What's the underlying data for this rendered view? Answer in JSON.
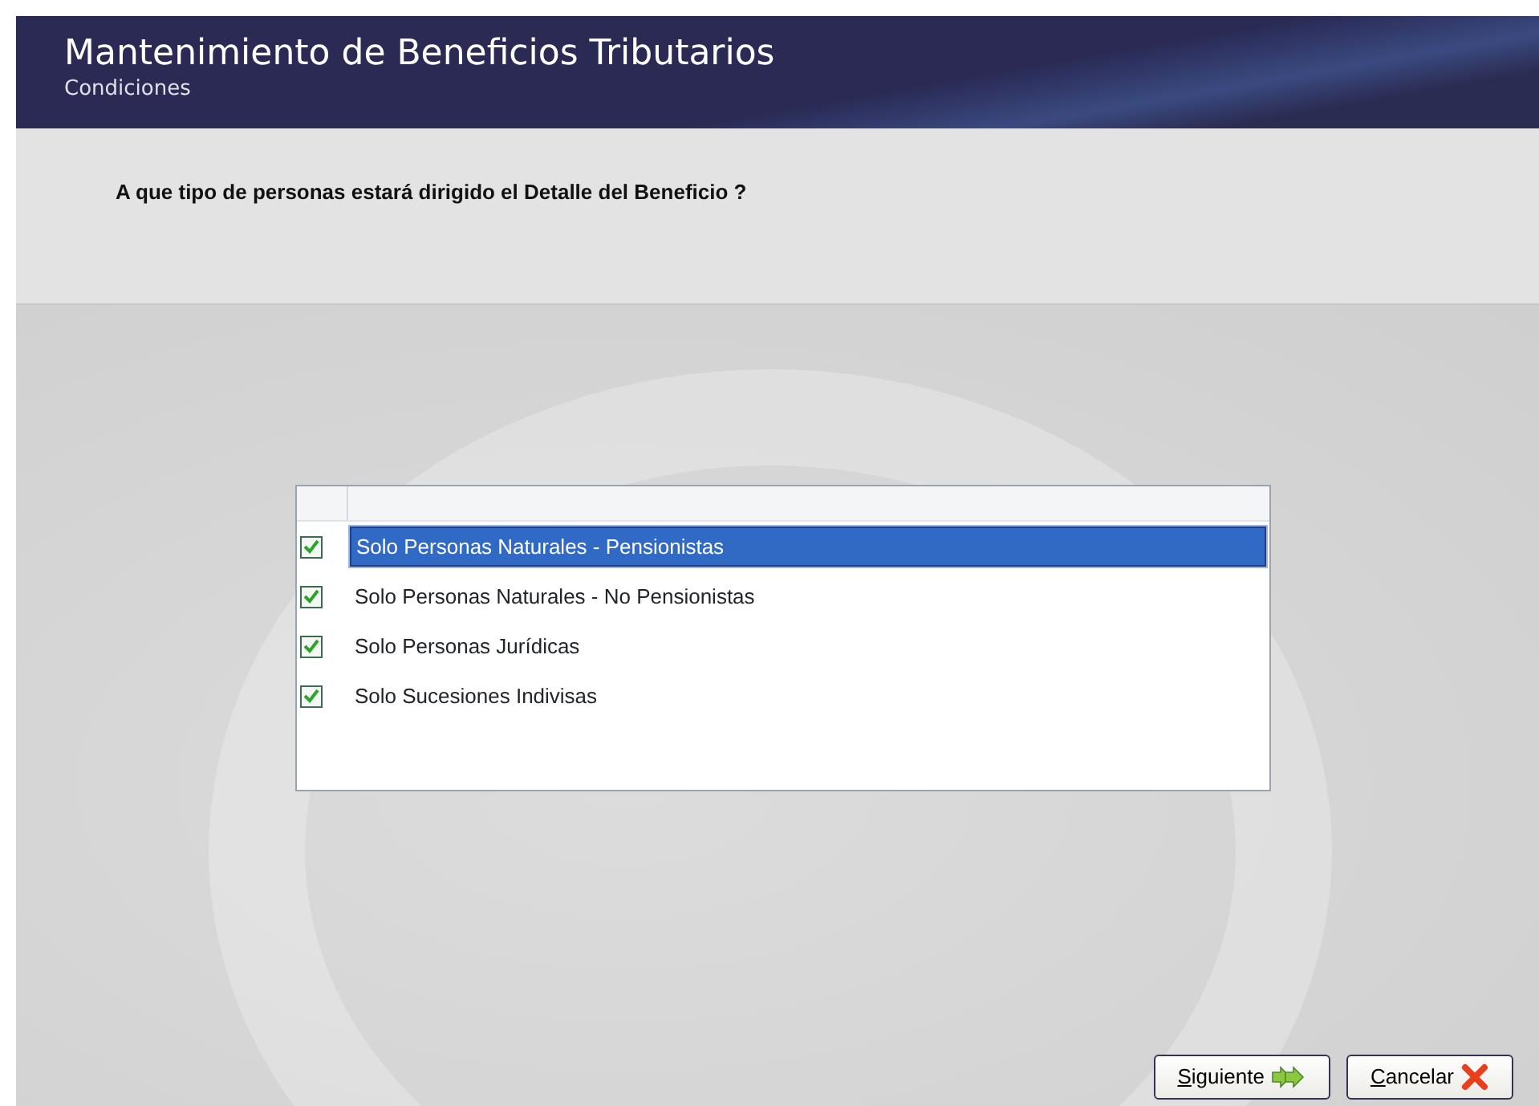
{
  "header": {
    "title": "Mantenimiento de Beneficios Tributarios",
    "subtitle": "Condiciones"
  },
  "question": "A que tipo de personas estará dirigido el Detalle del Beneficio ?",
  "options": [
    {
      "label": "Solo Personas Naturales - Pensionistas",
      "checked": true,
      "selected": true
    },
    {
      "label": "Solo Personas Naturales - No Pensionistas",
      "checked": true,
      "selected": false
    },
    {
      "label": "Solo Personas Jurídicas",
      "checked": true,
      "selected": false
    },
    {
      "label": "Solo Sucesiones Indivisas",
      "checked": true,
      "selected": false
    }
  ],
  "buttons": [
    {
      "label": "Siguiente",
      "kind": "next"
    },
    {
      "label": "Cancelar",
      "kind": "cancel"
    }
  ]
}
